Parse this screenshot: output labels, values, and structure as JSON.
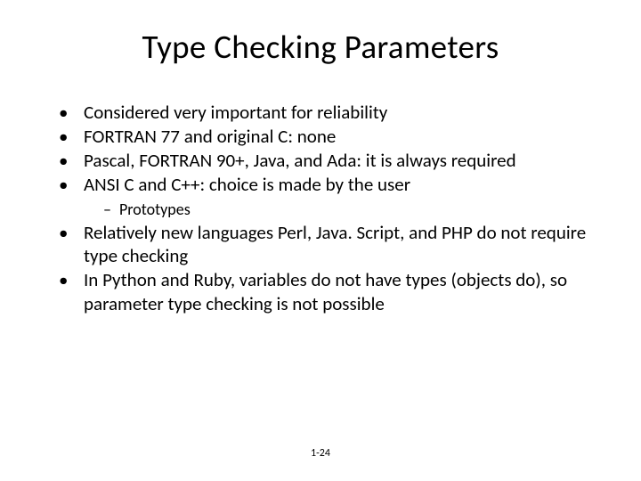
{
  "title": "Type Checking Parameters",
  "bullets": {
    "b1": "Considered very important for reliability",
    "b2": "FORTRAN 77 and original C: none",
    "b3": "Pascal, FORTRAN 90+, Java, and Ada: it is always required",
    "b4": "ANSI C and C++: choice is made by the user",
    "sub1": "Prototypes",
    "b5": "Relatively new languages Perl, Java. Script, and PHP do not require type checking",
    "b6": "In Python and Ruby, variables do not have types (objects do), so parameter type checking is not possible"
  },
  "footer": "1-24"
}
